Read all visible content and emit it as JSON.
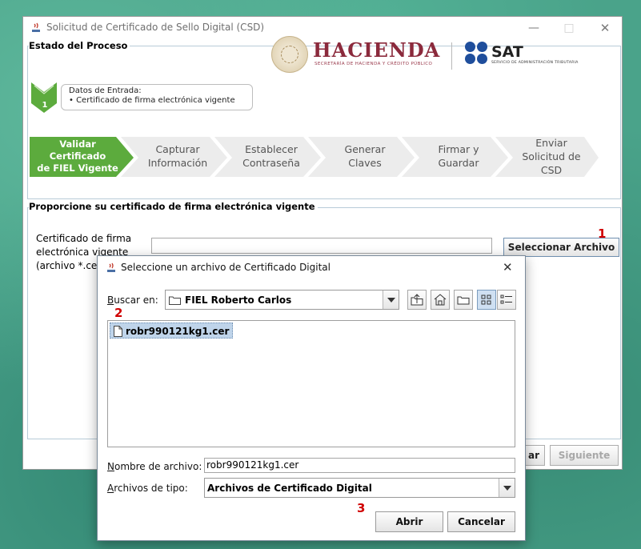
{
  "window": {
    "title": "Solicitud de Certificado de Sello Digital (CSD)",
    "min_icon": "minimize-icon",
    "max_icon": "maximize-icon",
    "close_icon": "close-icon"
  },
  "process": {
    "section_title": "Estado del Proceso",
    "logo_hacienda": "HACIENDA",
    "logo_hacienda_sub": "SECRETARÍA DE HACIENDA Y CRÉDITO PÚBLICO",
    "logo_sat": "SAT",
    "logo_sat_sub": "SERVICIO DE ADMINISTRACIÓN TRIBUTARIA",
    "step_number": "1",
    "input_title": "Datos de Entrada:",
    "input_bullet": "•   Certificado de firma electrónica vigente",
    "steps": [
      {
        "label_1": "Validar Certificado",
        "label_2": "de FIEL Vigente",
        "label_3": ""
      },
      {
        "label_1": "Capturar",
        "label_2": "Información",
        "label_3": ""
      },
      {
        "label_1": "Establecer",
        "label_2": "Contraseña",
        "label_3": ""
      },
      {
        "label_1": "Generar",
        "label_2": "Claves",
        "label_3": ""
      },
      {
        "label_1": "Firmar y",
        "label_2": "Guardar",
        "label_3": ""
      },
      {
        "label_1": "Enviar",
        "label_2": "Solicitud de",
        "label_3": "CSD"
      }
    ],
    "colors": {
      "active_step": "#5cab3d",
      "inactive_step": "#ececec"
    }
  },
  "certificate": {
    "section_title": "Proporcione su certificado de firma electrónica vigente",
    "label_1": "Certificado de firma",
    "label_2": "electrónica vigente",
    "label_3": "(archivo *.cer)",
    "path_value": "",
    "select_button": "Seleccionar Archivo",
    "prev_button": "ar",
    "next_button": "Siguiente"
  },
  "annotations": {
    "m1": "1",
    "m2": "2",
    "m3": "3"
  },
  "dialog": {
    "title": "Seleccione un archivo de Certificado Digital",
    "close_icon": "close-icon",
    "look_in_label_u": "B",
    "look_in_label_rest": "uscar en:",
    "look_in_value": "FIEL Roberto Carlos",
    "toolbar_icons": [
      "up-folder-icon",
      "home-folder-icon",
      "new-folder-icon",
      "list-view-icon",
      "details-view-icon"
    ],
    "files": [
      {
        "name": "robr990121kg1.cer",
        "icon": "file-icon"
      }
    ],
    "filename_label_u": "N",
    "filename_label_rest": "ombre de archivo:",
    "filename_value": "robr990121kg1.cer",
    "filetype_label_u": "A",
    "filetype_label_rest": "rchivos de tipo:",
    "filetype_value": "Archivos de Certificado Digital",
    "open_button": "Abrir",
    "cancel_button": "Cancelar"
  }
}
